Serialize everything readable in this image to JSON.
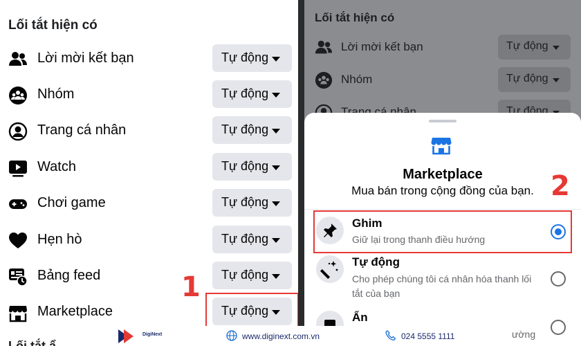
{
  "left": {
    "section_title": "Lối tắt hiện có",
    "items": [
      {
        "label": "Lời mời kết bạn",
        "icon": "friends-icon",
        "value": "Tự động"
      },
      {
        "label": "Nhóm",
        "icon": "groups-icon",
        "value": "Tự động"
      },
      {
        "label": "Trang cá nhân",
        "icon": "profile-icon",
        "value": "Tự động"
      },
      {
        "label": "Watch",
        "icon": "watch-icon",
        "value": "Tự động"
      },
      {
        "label": "Chơi game",
        "icon": "gaming-icon",
        "value": "Tự động"
      },
      {
        "label": "Hẹn hò",
        "icon": "dating-heart-icon",
        "value": "Tự động"
      },
      {
        "label": "Bảng feed",
        "icon": "feed-icon",
        "value": "Tự động"
      },
      {
        "label": "Marketplace",
        "icon": "marketplace-icon",
        "value": "Tự động"
      }
    ],
    "next_section_partial": "Lối tắt ẩ"
  },
  "step_labels": {
    "one": "1",
    "two": "2"
  },
  "right": {
    "section_title": "Lối tắt hiện có",
    "items": [
      {
        "label": "Lời mời kết bạn",
        "value": "Tự động"
      },
      {
        "label": "Nhóm",
        "value": "Tự động"
      },
      {
        "label": "Trang cá nhân",
        "value": "Tự động"
      }
    ]
  },
  "sheet": {
    "icon": "marketplace-icon",
    "title": "Marketplace",
    "subtitle": "Mua bán trong cộng đồng của bạn.",
    "options": [
      {
        "title": "Ghim",
        "desc": "Giữ lại trong thanh điều hướng",
        "icon": "pin-icon",
        "selected": true
      },
      {
        "title": "Tự động",
        "desc": "Cho phép chúng tôi cá nhân hóa thanh lối tắt của bạn",
        "icon": "magic-wand-icon",
        "selected": false
      },
      {
        "title": "Ẩn",
        "desc": "ường",
        "icon": "hide-icon",
        "selected": false
      }
    ]
  },
  "footer": {
    "brand": "DigiNext",
    "website": "www.diginext.com.vn",
    "phone": "024 5555 1111"
  },
  "colors": {
    "accent": "#1b74e4",
    "annotation": "#e53935",
    "chip": "#e4e6eb"
  }
}
